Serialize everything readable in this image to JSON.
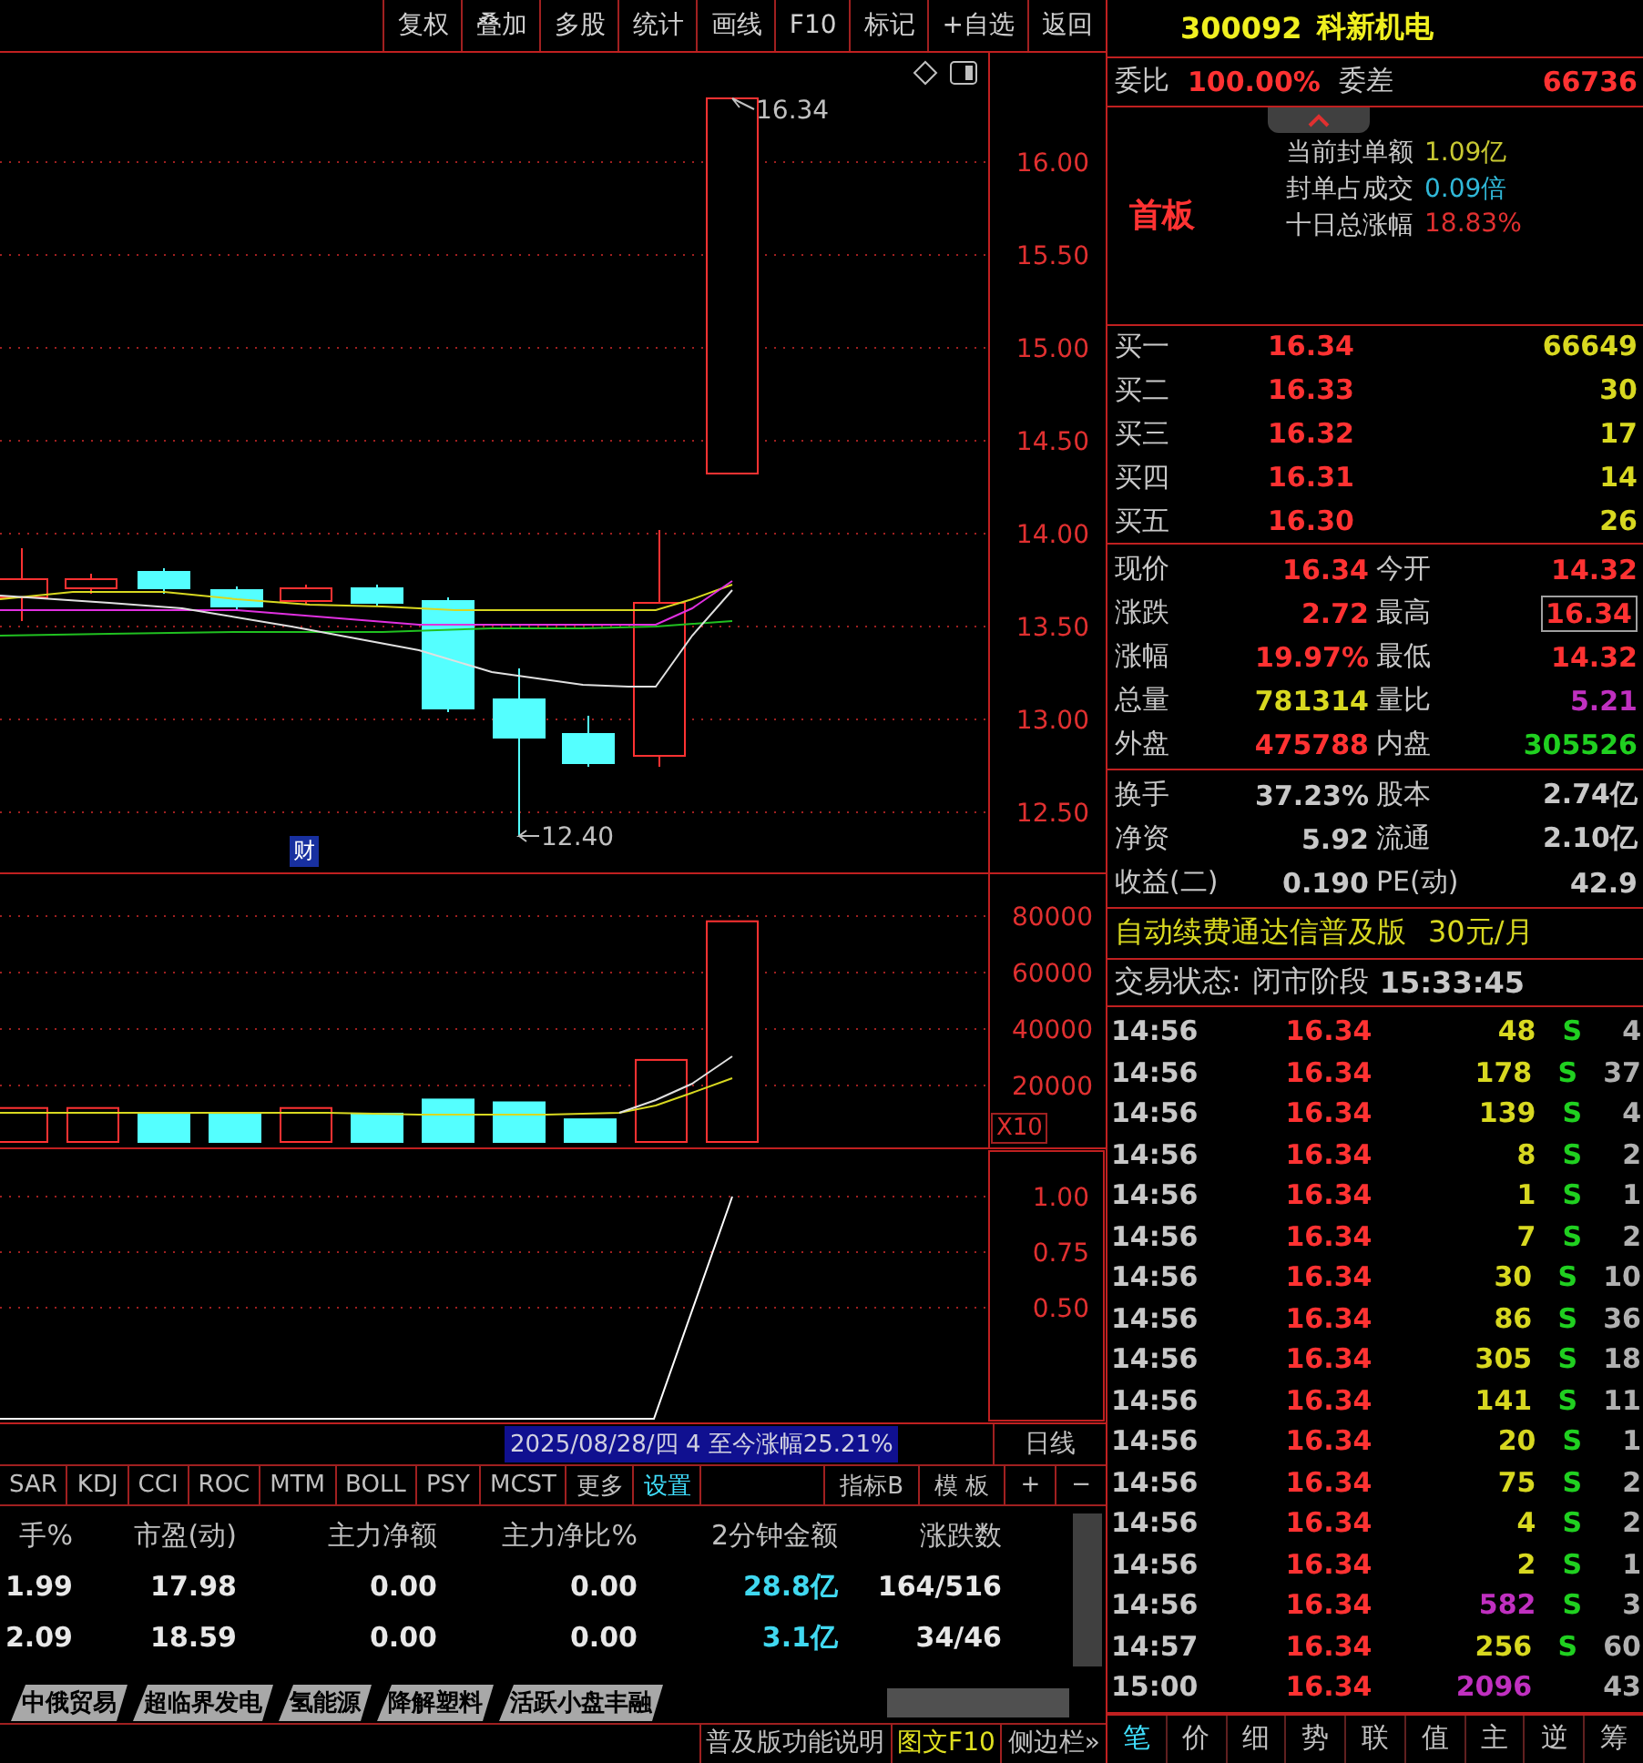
{
  "toolbar": [
    "复权",
    "叠加",
    "多股",
    "统计",
    "画线",
    "F10",
    "标记",
    "+自选",
    "返回"
  ],
  "price_axis": [
    "16.00",
    "15.50",
    "15.00",
    "14.50",
    "14.00",
    "13.50",
    "13.00",
    "12.50"
  ],
  "high_label": "16.34",
  "low_label": "12.40",
  "event_marker": "财",
  "volume_panel": {
    "axis_labels": [
      "80000",
      "60000",
      "40000",
      "20000"
    ],
    "scale": "X10"
  },
  "indicator_panel": {
    "axis_labels": [
      "1.00",
      "0.75",
      "0.50"
    ]
  },
  "period_bar": {
    "info": "2025/08/28/四 4 至今涨幅25.21%",
    "period": "日线"
  },
  "indicator_tabs": [
    {
      "label": "SAR",
      "selected": false
    },
    {
      "label": "KDJ",
      "selected": false
    },
    {
      "label": "CCI",
      "selected": false
    },
    {
      "label": "ROC",
      "selected": false
    },
    {
      "label": "MTM",
      "selected": false
    },
    {
      "label": "BOLL",
      "selected": false
    },
    {
      "label": "PSY",
      "selected": false
    },
    {
      "label": "MCST",
      "selected": false
    },
    {
      "label": "更多",
      "selected": false
    },
    {
      "label": "设置",
      "selected": true
    }
  ],
  "indicator_tools": [
    "指标B",
    "模 板",
    "+",
    "−"
  ],
  "table": {
    "columns": [
      "手%",
      "市盈(动)",
      "主力净额",
      "主力净比%",
      "2分钟金额",
      "涨跌数"
    ],
    "rows": [
      [
        "1.99",
        "17.98",
        "0.00",
        "0.00",
        "28.8亿",
        "164/516"
      ],
      [
        "2.09",
        "18.59",
        "0.00",
        "0.00",
        "3.1亿",
        "34/46"
      ]
    ]
  },
  "sector_tabs": [
    "中俄贸易",
    "超临界发电",
    "氢能源",
    "降解塑料",
    "活跃小盘丰融"
  ],
  "footer_links": [
    {
      "label": "普及版功能说明",
      "kind": "plain"
    },
    {
      "label": "图文F10",
      "kind": "accent"
    },
    {
      "label": "侧边栏»",
      "kind": "plain"
    }
  ],
  "stock": {
    "code": "300092",
    "name": "科新机电"
  },
  "order_ratio": {
    "label": "委比",
    "value": "100.00%",
    "diff_label": "委差",
    "diff_value": "66736"
  },
  "limit_up": {
    "tag": "首板",
    "rows": [
      {
        "label": "当前封单额",
        "value": "1.09亿",
        "color": "#c8c832"
      },
      {
        "label": "封单占成交",
        "value": "0.09倍",
        "color": "#30b8d8"
      },
      {
        "label": "十日总涨幅",
        "value": "18.83%",
        "color": "#e03030"
      }
    ]
  },
  "bids": [
    {
      "label": "买一",
      "price": "16.34",
      "volume": "66649"
    },
    {
      "label": "买二",
      "price": "16.33",
      "volume": "30"
    },
    {
      "label": "买三",
      "price": "16.32",
      "volume": "17"
    },
    {
      "label": "买四",
      "price": "16.31",
      "volume": "14"
    },
    {
      "label": "买五",
      "price": "16.30",
      "volume": "26"
    }
  ],
  "quotes": [
    {
      "label": "现价",
      "value": "16.34",
      "color": "#ff3232",
      "highlighted": false
    },
    {
      "label": "今开",
      "value": "14.32",
      "color": "#ff3232",
      "highlighted": false
    },
    {
      "label": "涨跌",
      "value": "2.72",
      "color": "#ff3232",
      "highlighted": false
    },
    {
      "label": "最高",
      "value": "16.34",
      "color": "#ff3232",
      "highlighted": true
    },
    {
      "label": "涨幅",
      "value": "19.97%",
      "color": "#ff3232",
      "highlighted": false
    },
    {
      "label": "最低",
      "value": "14.32",
      "color": "#ff3232",
      "highlighted": false
    },
    {
      "label": "总量",
      "value": "781314",
      "color": "#d8d820",
      "highlighted": false
    },
    {
      "label": "量比",
      "value": "5.21",
      "color": "#c030c0",
      "highlighted": false
    },
    {
      "label": "外盘",
      "value": "475788",
      "color": "#ff3232",
      "highlighted": false
    },
    {
      "label": "内盘",
      "value": "305526",
      "color": "#20d020",
      "highlighted": false
    }
  ],
  "stats": [
    {
      "label": "换手",
      "value": "37.23%"
    },
    {
      "label": "股本",
      "value": "2.74亿"
    },
    {
      "label": "净资",
      "value": "5.92"
    },
    {
      "label": "流通",
      "value": "2.10亿"
    },
    {
      "label": "收益(二)",
      "value": "0.190"
    },
    {
      "label": "PE(动)",
      "value": "42.9"
    }
  ],
  "promo": {
    "text": "自动续费通达信普及版",
    "price": "30元/月"
  },
  "trade_status": {
    "label": "交易状态:",
    "value": "闭市阶段",
    "time": "15:33:45"
  },
  "ticks": [
    {
      "time": "14:56",
      "price": "16.34",
      "volume": "48",
      "large": false,
      "side": "S",
      "count": "4"
    },
    {
      "time": "14:56",
      "price": "16.34",
      "volume": "178",
      "large": false,
      "side": "S",
      "count": "37"
    },
    {
      "time": "14:56",
      "price": "16.34",
      "volume": "139",
      "large": false,
      "side": "S",
      "count": "4"
    },
    {
      "time": "14:56",
      "price": "16.34",
      "volume": "8",
      "large": false,
      "side": "S",
      "count": "2"
    },
    {
      "time": "14:56",
      "price": "16.34",
      "volume": "1",
      "large": false,
      "side": "S",
      "count": "1"
    },
    {
      "time": "14:56",
      "price": "16.34",
      "volume": "7",
      "large": false,
      "side": "S",
      "count": "2"
    },
    {
      "time": "14:56",
      "price": "16.34",
      "volume": "30",
      "large": false,
      "side": "S",
      "count": "10"
    },
    {
      "time": "14:56",
      "price": "16.34",
      "volume": "86",
      "large": false,
      "side": "S",
      "count": "36"
    },
    {
      "time": "14:56",
      "price": "16.34",
      "volume": "305",
      "large": false,
      "side": "S",
      "count": "18"
    },
    {
      "time": "14:56",
      "price": "16.34",
      "volume": "141",
      "large": false,
      "side": "S",
      "count": "11"
    },
    {
      "time": "14:56",
      "price": "16.34",
      "volume": "20",
      "large": false,
      "side": "S",
      "count": "1"
    },
    {
      "time": "14:56",
      "price": "16.34",
      "volume": "75",
      "large": false,
      "side": "S",
      "count": "2"
    },
    {
      "time": "14:56",
      "price": "16.34",
      "volume": "4",
      "large": false,
      "side": "S",
      "count": "2"
    },
    {
      "time": "14:56",
      "price": "16.34",
      "volume": "2",
      "large": false,
      "side": "S",
      "count": "1"
    },
    {
      "time": "14:56",
      "price": "16.34",
      "volume": "582",
      "large": true,
      "side": "S",
      "count": "3"
    },
    {
      "time": "14:57",
      "price": "16.34",
      "volume": "256",
      "large": false,
      "side": "S",
      "count": "60"
    },
    {
      "time": "15:00",
      "price": "16.34",
      "volume": "2096",
      "large": true,
      "count": "43"
    }
  ],
  "detail_tabs": [
    {
      "label": "笔",
      "selected": true
    },
    {
      "label": "价",
      "selected": false
    },
    {
      "label": "细",
      "selected": false
    },
    {
      "label": "势",
      "selected": false
    },
    {
      "label": "联",
      "selected": false
    },
    {
      "label": "值",
      "selected": false
    },
    {
      "label": "主",
      "selected": false
    },
    {
      "label": "逆",
      "selected": false
    },
    {
      "label": "筹",
      "selected": false
    }
  ]
}
